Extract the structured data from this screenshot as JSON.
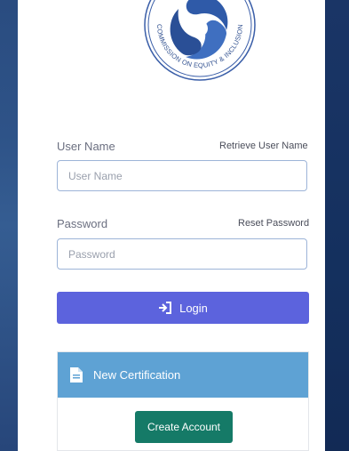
{
  "logo": {
    "ring_text": "COMMISSION ON EQUITY & INCLUSION"
  },
  "username": {
    "label": "User Name",
    "retrieve_link": "Retrieve User Name",
    "placeholder": "User Name",
    "value": ""
  },
  "password": {
    "label": "Password",
    "reset_link": "Reset Password",
    "placeholder": "Password",
    "value": ""
  },
  "login": {
    "label": "Login",
    "icon": "sign-in-icon"
  },
  "certification": {
    "title": "New Certification",
    "icon": "document-icon",
    "create_label": "Create Account"
  },
  "colors": {
    "login_button": "#5c63dd",
    "panel_header": "#5ea2d4",
    "create_button": "#157a67",
    "input_border": "#9db4d8"
  }
}
